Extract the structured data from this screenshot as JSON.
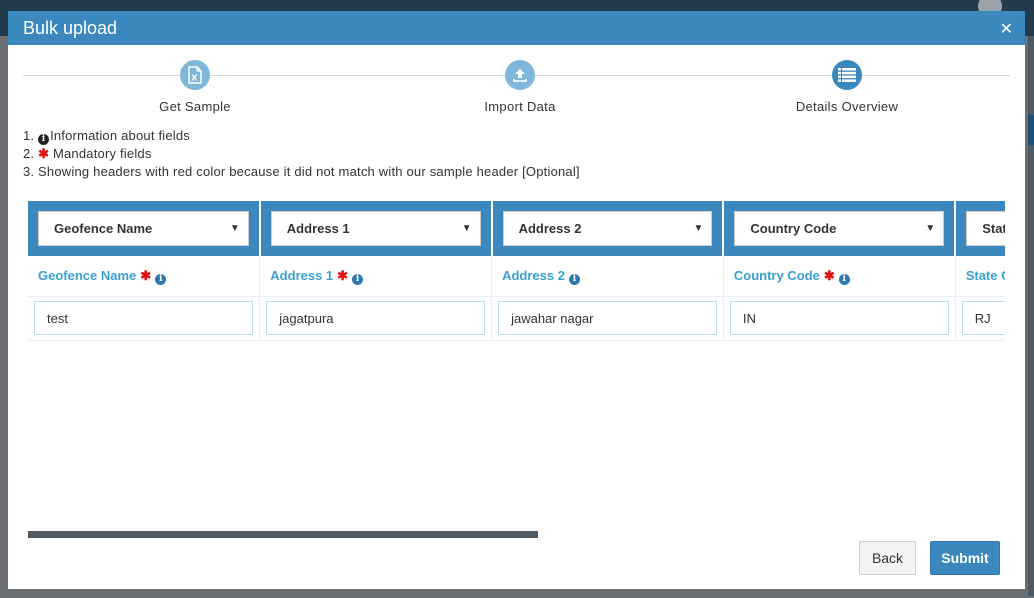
{
  "modal": {
    "title": "Bulk upload",
    "close_glyph": "✕"
  },
  "steps": [
    {
      "label": "Get Sample",
      "icon": "excel-file-icon",
      "state": "done"
    },
    {
      "label": "Import Data",
      "icon": "upload-icon",
      "state": "done"
    },
    {
      "label": "Details Overview",
      "icon": "list-icon",
      "state": "active"
    }
  ],
  "info": {
    "line1_prefix": "1. ",
    "line1_text": "Information about fields",
    "line2_prefix": "2. ",
    "line2_star": "✱",
    "line2_text": " Mandatory fields",
    "line3": "3. Showing headers with red color because it did not match with our sample header [Optional]"
  },
  "columns": [
    {
      "select": "Geofence Name",
      "label": "Geofence Name",
      "mandatory": true,
      "value": "test"
    },
    {
      "select": "Address 1",
      "label": "Address 1",
      "mandatory": true,
      "value": "jagatpura"
    },
    {
      "select": "Address 2",
      "label": "Address 2",
      "mandatory": false,
      "value": "jawahar nagar"
    },
    {
      "select": "Country Code",
      "label": "Country Code",
      "mandatory": true,
      "value": "IN"
    },
    {
      "select": "State Code",
      "label": "State Code",
      "mandatory": true,
      "value": "RJ"
    }
  ],
  "buttons": {
    "back": "Back",
    "submit": "Submit"
  },
  "colors": {
    "primary": "#3a88bd",
    "label_blue": "#3aa0d2",
    "mandatory_red": "#e01010"
  }
}
